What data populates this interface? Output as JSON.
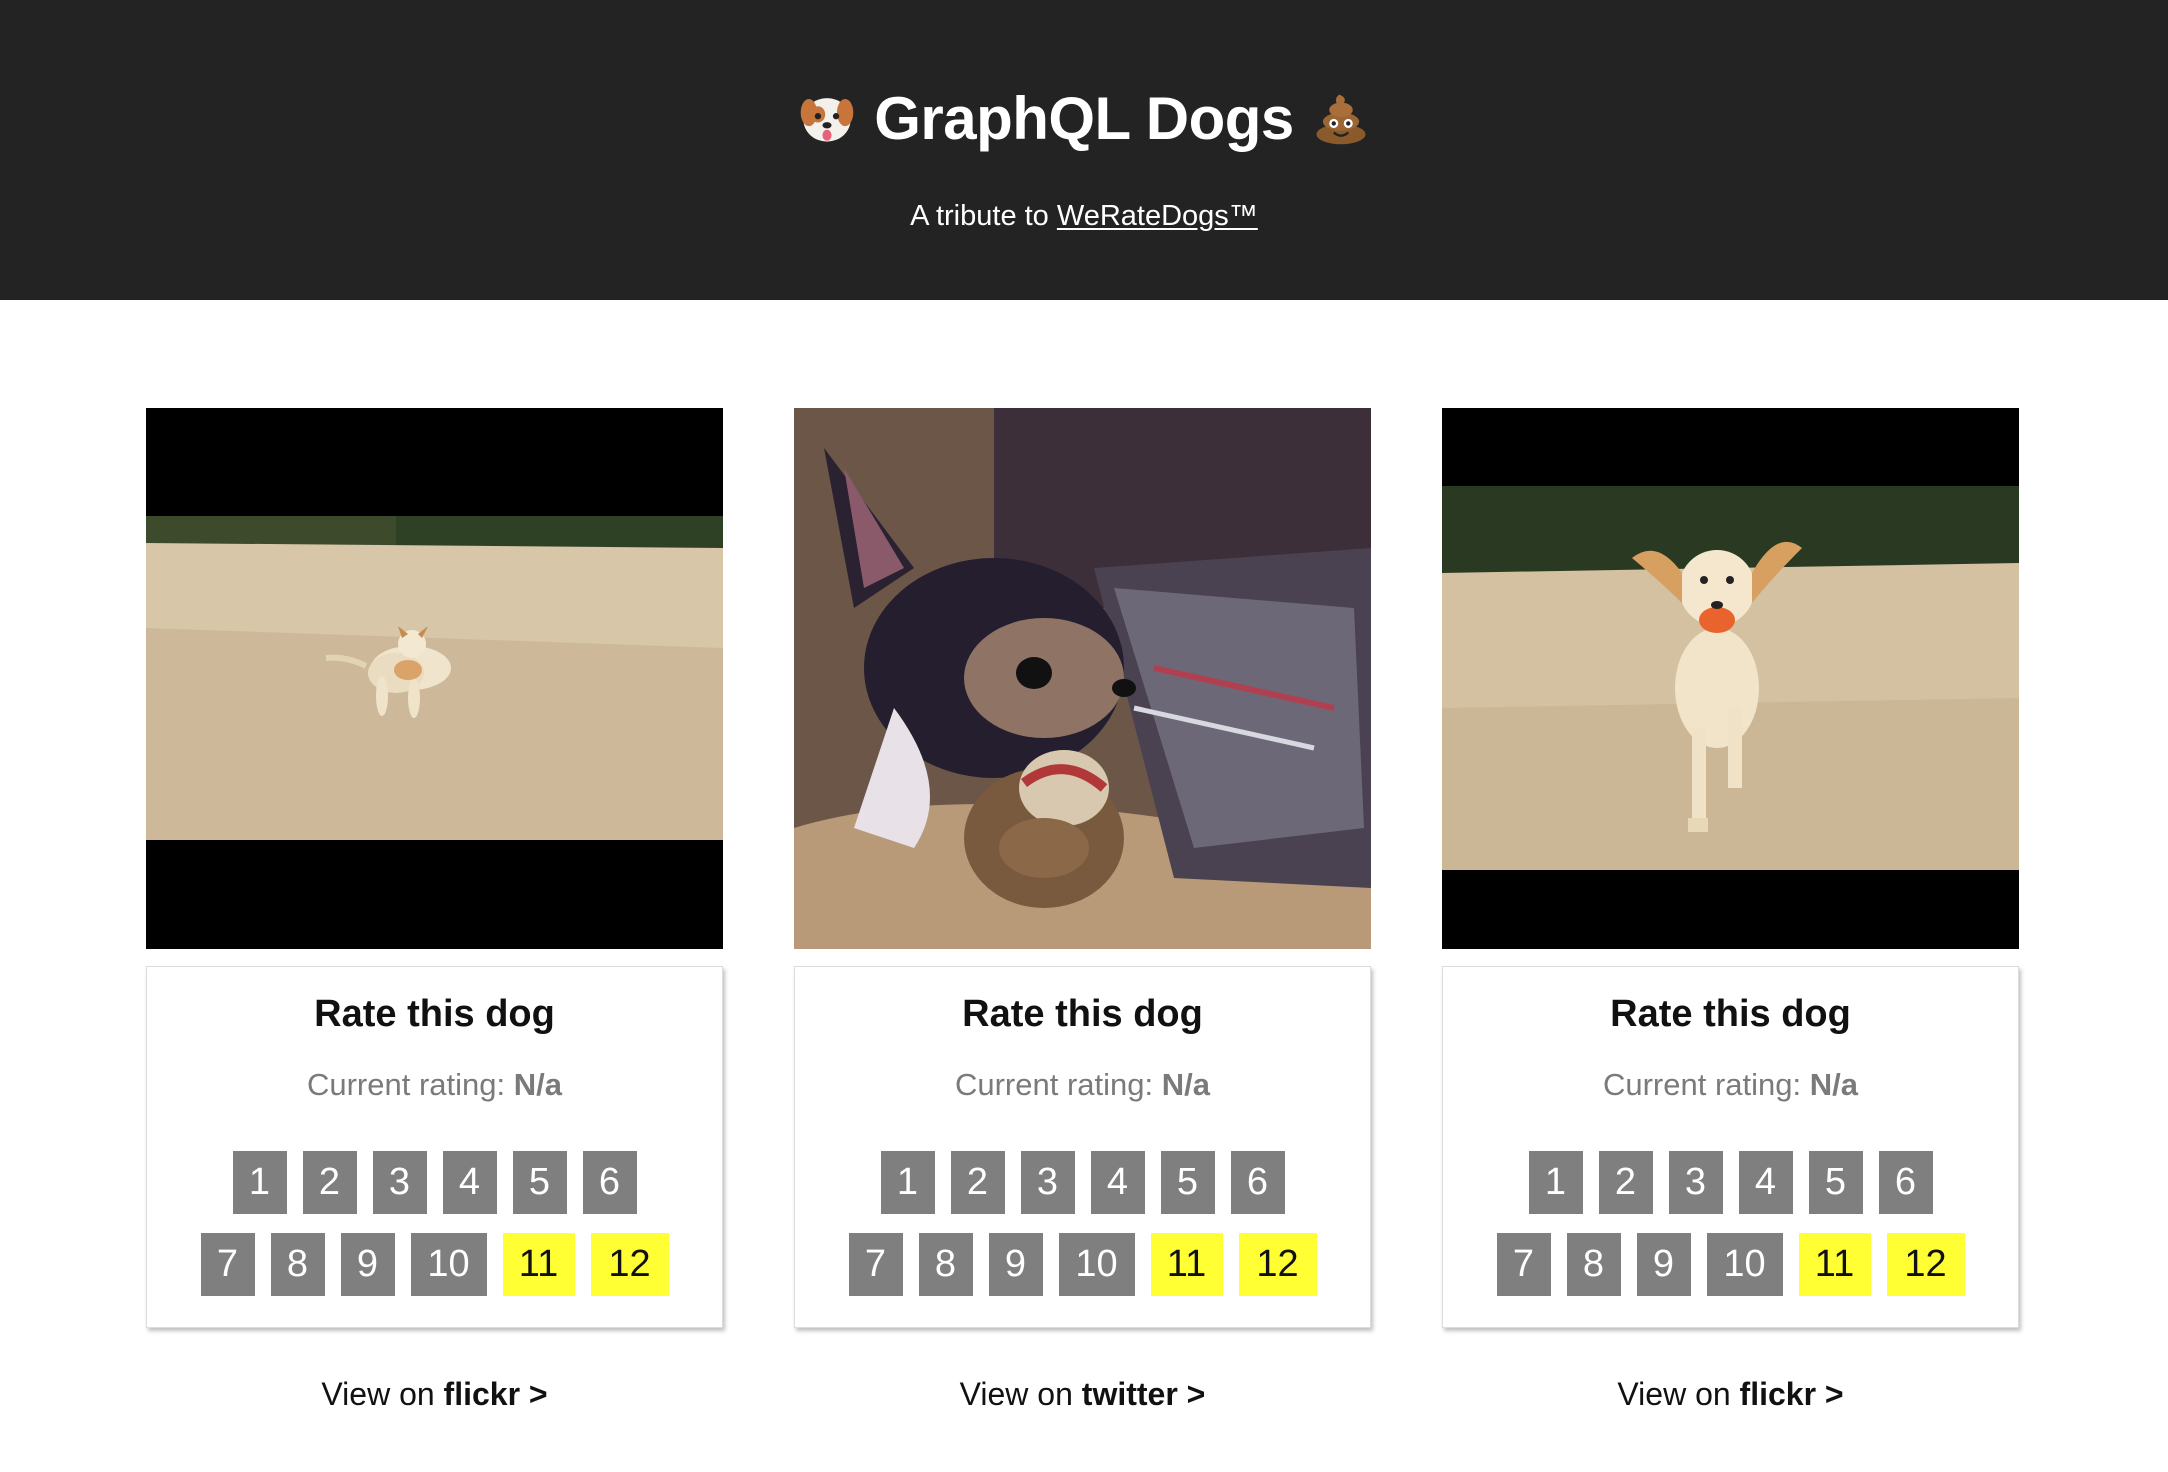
{
  "header": {
    "title": "GraphQL Dogs",
    "left_icon": "dog-face-icon",
    "right_icon": "pile-of-poo-icon",
    "subtitle_prefix": "A tribute to ",
    "subtitle_link": "WeRateDogs™"
  },
  "cards": [
    {
      "image_alt": "dog running on sand",
      "rate_title": "Rate this dog",
      "rating_label": "Current rating: ",
      "rating_value": "N/a",
      "view_prefix": "View on ",
      "view_source": "flickr >"
    },
    {
      "image_alt": "chihuahua with toy monkey",
      "rate_title": "Rate this dog",
      "rating_label": "Current rating: ",
      "rating_value": "N/a",
      "view_prefix": "View on ",
      "view_source": "twitter >"
    },
    {
      "image_alt": "golden retriever puppy running with ball",
      "rate_title": "Rate this dog",
      "rating_label": "Current rating: ",
      "rating_value": "N/a",
      "view_prefix": "View on ",
      "view_source": "flickr >"
    }
  ],
  "rating_buttons": [
    "1",
    "2",
    "3",
    "4",
    "5",
    "6",
    "7",
    "8",
    "9",
    "10",
    "11",
    "12"
  ],
  "colors": {
    "header_bg": "#232323",
    "button_gray": "#7f7f7f",
    "button_highlight": "#ffff33"
  }
}
